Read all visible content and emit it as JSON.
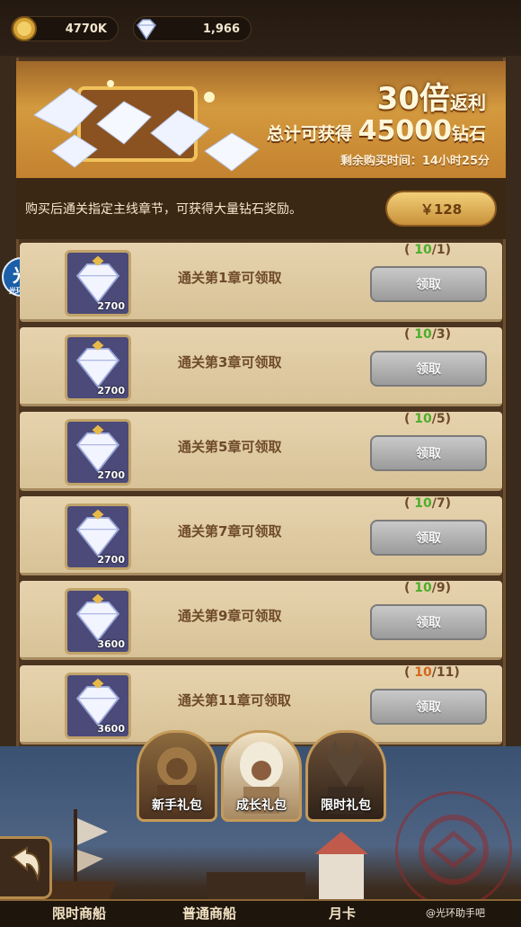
{
  "resources": {
    "gold_value": "4770K",
    "diamond_value": "1,966"
  },
  "banner": {
    "multiplier": "30倍",
    "multiplier_suffix": "返利",
    "total_prefix": "总计可获得",
    "total_amount": "45000",
    "total_suffix": "钻石",
    "time_remaining": "剩余购买时间：14小时25分"
  },
  "info": {
    "description": "购买后通关指定主线章节，可获得大量钻石奖励。",
    "price": "￥128"
  },
  "side_badge": {
    "big": "光",
    "small": "光环助手"
  },
  "rewards": [
    {
      "amount": "2700",
      "label": "通关第1章可领取",
      "current": "10",
      "target": "1",
      "status": "complete",
      "button": "领取"
    },
    {
      "amount": "2700",
      "label": "通关第3章可领取",
      "current": "10",
      "target": "3",
      "status": "complete",
      "button": "领取"
    },
    {
      "amount": "2700",
      "label": "通关第5章可领取",
      "current": "10",
      "target": "5",
      "status": "complete",
      "button": "领取"
    },
    {
      "amount": "2700",
      "label": "通关第7章可领取",
      "current": "10",
      "target": "7",
      "status": "complete",
      "button": "领取"
    },
    {
      "amount": "3600",
      "label": "通关第9章可领取",
      "current": "10",
      "target": "9",
      "status": "complete",
      "button": "领取"
    },
    {
      "amount": "3600",
      "label": "通关第11章可领取",
      "current": "10",
      "target": "11",
      "status": "incomplete",
      "button": "领取"
    }
  ],
  "gift_tabs": [
    "新手礼包",
    "成长礼包",
    "限时礼包"
  ],
  "bottom_nav": [
    "限时商船",
    "普通商船",
    "月卡"
  ],
  "watermark": "@光环助手吧",
  "colors": {
    "progress_complete": "#4fae2c",
    "progress_incomplete": "#d2691e",
    "claim_button": "#a7a7a7",
    "price_button": "#e3b45d"
  }
}
